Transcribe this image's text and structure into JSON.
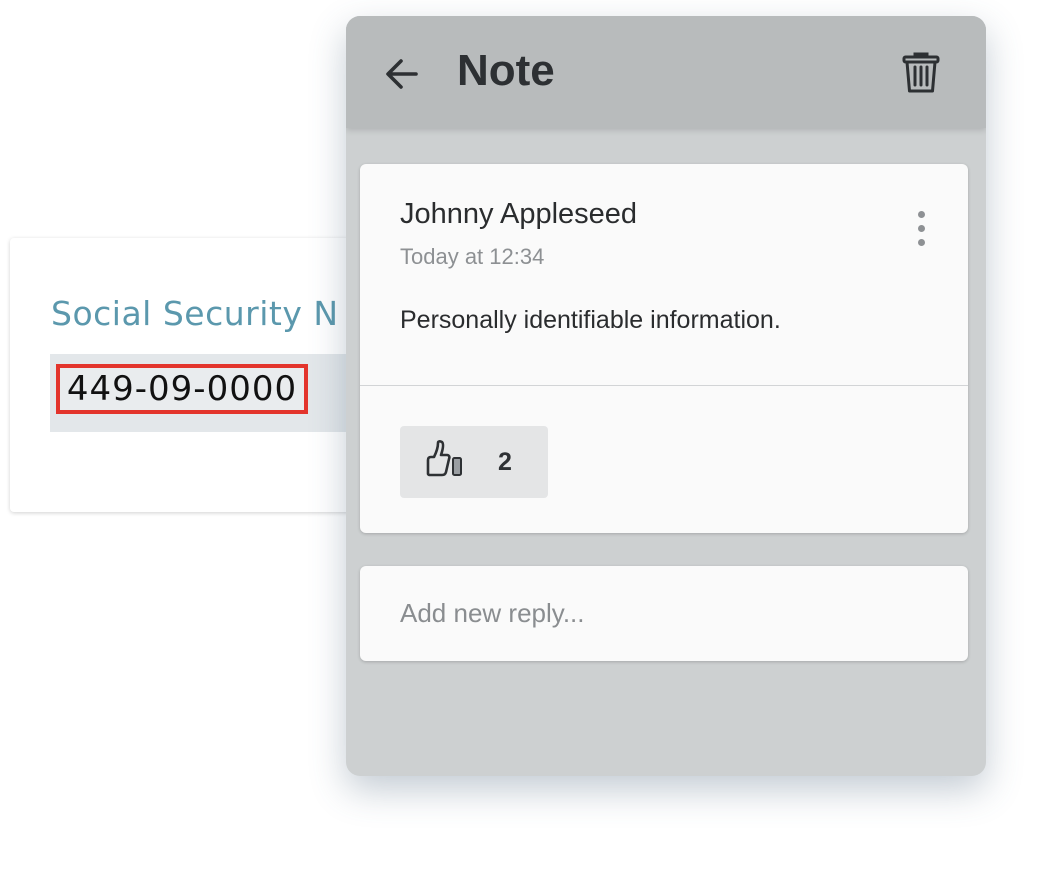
{
  "document": {
    "field_label": "Social Security N",
    "field_value": "449-09-0000",
    "highlight_color": "#e3342c",
    "label_color": "#5b98ad"
  },
  "note_panel": {
    "title": "Note",
    "back_icon": "arrow-left-icon",
    "delete_icon": "trash-icon",
    "comment": {
      "author": "Johnny Appleseed",
      "timestamp": "Today at 12:34",
      "body": "Personally identifiable information.",
      "more_icon": "more-vertical-icon",
      "like_icon": "thumbs-up-icon",
      "like_count": "2"
    },
    "reply": {
      "placeholder": "Add new reply...",
      "value": ""
    }
  }
}
